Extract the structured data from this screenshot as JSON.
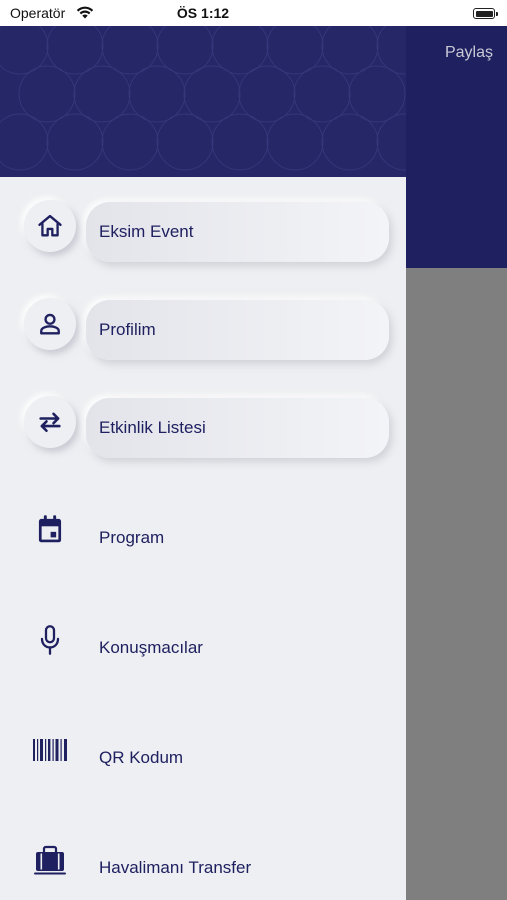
{
  "status_bar": {
    "carrier": "Operatör",
    "time": "ÖS 1:12"
  },
  "background_app": {
    "share_label": "Paylaş",
    "header_color": "#1f2060"
  },
  "drawer": {
    "header_color": "#252766",
    "accent_color": "#1f2060",
    "items": [
      {
        "label": "Eksim Event",
        "icon": "home-icon",
        "style": "raised"
      },
      {
        "label": "Profilim",
        "icon": "person-icon",
        "style": "raised"
      },
      {
        "label": "Etkinlik Listesi",
        "icon": "swap-arrows-icon",
        "style": "raised"
      },
      {
        "label": "Program",
        "icon": "calendar-icon",
        "style": "plain"
      },
      {
        "label": "Konuşmacılar",
        "icon": "microphone-icon",
        "style": "plain"
      },
      {
        "label": "QR Kodum",
        "icon": "barcode-icon",
        "style": "plain"
      },
      {
        "label": "Havalimanı Transfer",
        "icon": "luggage-icon",
        "style": "plain"
      }
    ]
  }
}
